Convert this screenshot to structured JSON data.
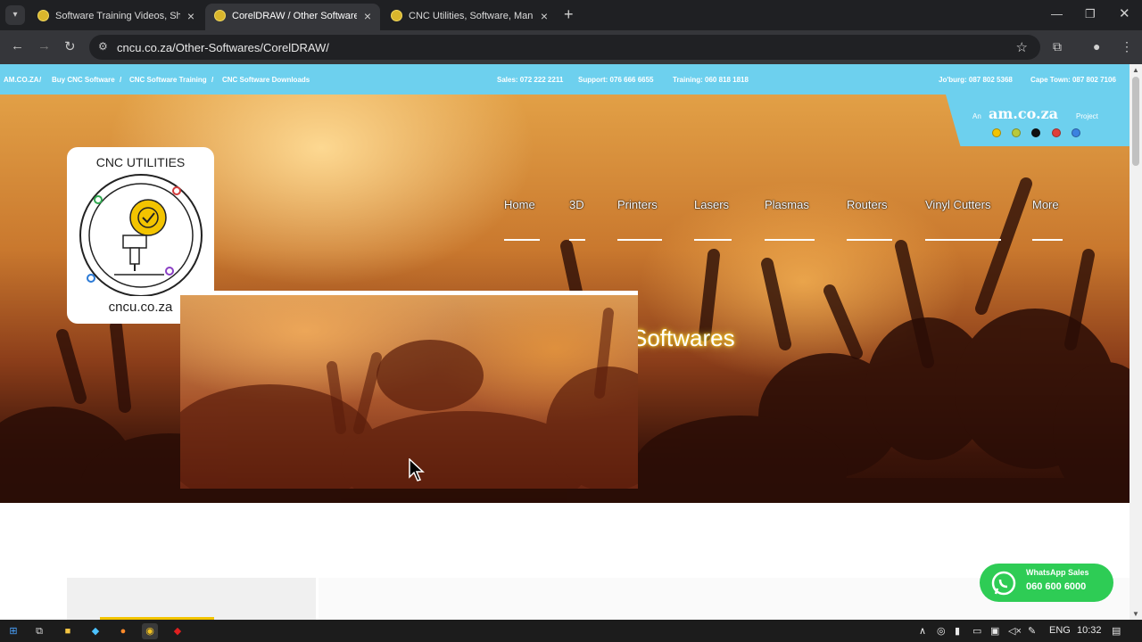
{
  "browser": {
    "tabs": [
      {
        "title": "Software Training Videos, Short",
        "active": false
      },
      {
        "title": "CorelDRAW / Other Softwares",
        "active": true
      },
      {
        "title": "CNC Utilities, Software, Manual",
        "active": false
      }
    ],
    "url": "cncu.co.za/Other-Softwares/CorelDRAW/"
  },
  "topbar": {
    "links": [
      "AM.CO.ZA",
      "Buy CNC Software",
      "CNC Software Training",
      "CNC Software Downloads"
    ],
    "sales": "Sales: 072 222 2211",
    "support": "Support: 076 666 6655",
    "training": "Training: 060 818 1818",
    "joburg": "Jo'burg: 087 802 5368",
    "capetown": "Cape Town: 087 802 7106"
  },
  "corner": {
    "an": "An",
    "brand": "am.co.za",
    "project": "Project"
  },
  "logo": {
    "top_text": "CNC UTILITIES",
    "bottom_text": "cncu.co.za"
  },
  "nav": {
    "items": [
      "Home",
      "3D",
      "Printers",
      "Lasers",
      "Plasmas",
      "Routers",
      "Vinyl Cutters",
      "More"
    ]
  },
  "hero": {
    "title_fragment": "Softwares"
  },
  "whatsapp": {
    "label": "WhatsApp Sales",
    "number": "060 600 6000"
  },
  "taskbar": {
    "lang": "ENG",
    "time": "10:32"
  },
  "colors": {
    "accent": "#6dd0ee",
    "whatsapp": "#2ecc55",
    "logo_gear": "#f3c400"
  }
}
